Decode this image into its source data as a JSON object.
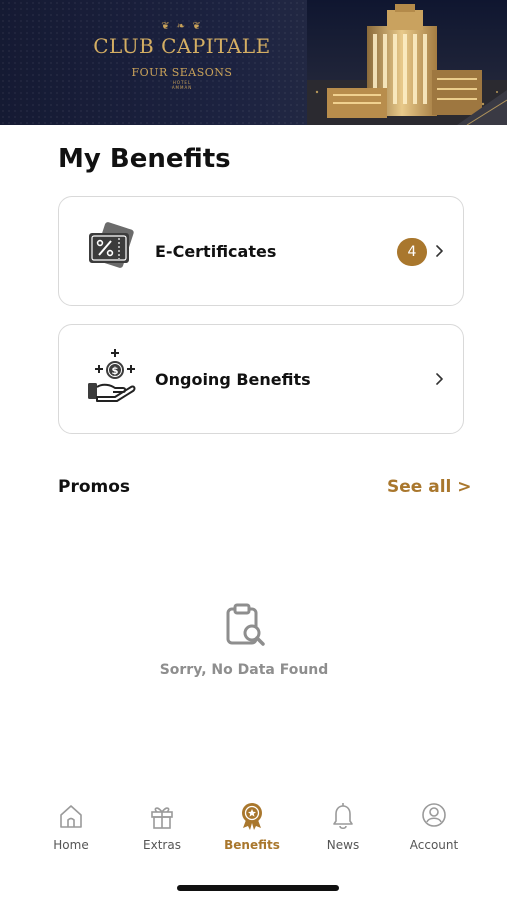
{
  "header": {
    "brand_title": "CLUB CAPITALE",
    "hotel_name": "FOUR SEASONS",
    "hotel_word": "HOTEL",
    "hotel_city": "AMMAN"
  },
  "page_title": "My Benefits",
  "benefits": [
    {
      "label": "E-Certificates",
      "icon": "ticket-percent-icon",
      "count": "4"
    },
    {
      "label": "Ongoing Benefits",
      "icon": "hand-coin-icon"
    }
  ],
  "promos": {
    "title": "Promos",
    "see_all": "See all >",
    "empty_text": "Sorry, No Data Found",
    "empty_icon": "clipboard-search-icon"
  },
  "bottom_nav": [
    {
      "label": "Home",
      "icon": "home-icon",
      "active": false
    },
    {
      "label": "Extras",
      "icon": "gift-icon",
      "active": false
    },
    {
      "label": "Benefits",
      "icon": "award-icon",
      "active": true
    },
    {
      "label": "News",
      "icon": "bell-icon",
      "active": false
    },
    {
      "label": "Account",
      "icon": "user-circle-icon",
      "active": false
    }
  ],
  "colors": {
    "accent": "#a9772d",
    "gold": "#d4ae63",
    "banner": "#1c2240",
    "muted": "#8e8e8e"
  }
}
